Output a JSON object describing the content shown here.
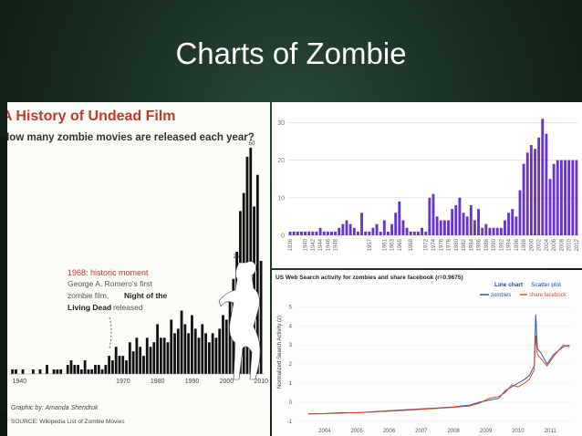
{
  "slide": {
    "title": "Charts of Zombie"
  },
  "colors": {
    "background": "#1d3528",
    "bar_purple": "#6a35c9",
    "zombies_line": "#2a56b8",
    "facebook_line": "#d6501f",
    "film_bar": "#111111"
  },
  "chart_data": [
    {
      "type": "bar",
      "title": "A History of Undead Film",
      "subtitle": "How many zombie movies are released each year?",
      "x_tick_labels": [
        "1940",
        "1970",
        "1980",
        "1990",
        "2000",
        "2010"
      ],
      "x": [
        1938,
        1939,
        1941,
        1944,
        1946,
        1948,
        1950,
        1951,
        1952,
        1954,
        1955,
        1956,
        1957,
        1958,
        1959,
        1960,
        1961,
        1962,
        1963,
        1964,
        1965,
        1966,
        1967,
        1968,
        1969,
        1970,
        1971,
        1972,
        1973,
        1974,
        1975,
        1976,
        1977,
        1978,
        1979,
        1980,
        1981,
        1982,
        1983,
        1984,
        1985,
        1986,
        1987,
        1988,
        1989,
        1990,
        1991,
        1992,
        1993,
        1994,
        1995,
        1996,
        1997,
        1998,
        1999,
        2000,
        2001,
        2002,
        2003,
        2004,
        2005,
        2006,
        2007,
        2008,
        2009,
        2010
      ],
      "values": [
        1,
        1,
        1,
        1,
        1,
        2,
        1,
        1,
        1,
        2,
        3,
        2,
        2,
        1,
        3,
        1,
        1,
        2,
        2,
        1,
        2,
        4,
        3,
        6,
        4,
        4,
        3,
        7,
        5,
        8,
        6,
        4,
        8,
        6,
        7,
        11,
        8,
        8,
        7,
        12,
        9,
        10,
        14,
        11,
        9,
        13,
        10,
        8,
        11,
        9,
        7,
        9,
        8,
        10,
        13,
        12,
        16,
        21,
        27,
        36,
        40,
        48,
        50,
        37,
        44,
        25
      ],
      "labels_on_bars": [
        "50",
        "25"
      ],
      "annotation": {
        "heading": "1968: historic moment",
        "body": [
          "George A. Romero's first",
          "zombie film,",
          "Night of the",
          "Living Dead",
          "released"
        ]
      },
      "credits": [
        "Graphic by: Amanda Shendruk",
        "SOURCE: Wikipedia List of Zombie Movies"
      ],
      "ylim": [
        0,
        52
      ]
    },
    {
      "type": "bar",
      "x": [
        "1936",
        "1940",
        "1942",
        "1944",
        "1946",
        "1948",
        "1957",
        "1961",
        "1963",
        "1965",
        "1968",
        "1972",
        "1974",
        "1976",
        "1978",
        "1980",
        "1982",
        "1984",
        "1986",
        "1988",
        "1990",
        "1992",
        "1994",
        "1996",
        "1998",
        "2000",
        "2002",
        "2004",
        "2006",
        "2008",
        "2010",
        "2012"
      ],
      "all_years": [
        1936,
        1937,
        1938,
        1939,
        1940,
        1941,
        1942,
        1943,
        1944,
        1945,
        1946,
        1947,
        1948,
        1949,
        1950,
        1951,
        1952,
        1953,
        1954,
        1955,
        1956,
        1957,
        1958,
        1959,
        1960,
        1961,
        1962,
        1963,
        1964,
        1965,
        1966,
        1967,
        1968,
        1969,
        1970,
        1971,
        1972,
        1973,
        1974,
        1975,
        1976,
        1977,
        1978,
        1979,
        1980,
        1981,
        1982,
        1983,
        1984,
        1985,
        1986,
        1987,
        1988,
        1989,
        1990,
        1991,
        1992,
        1993,
        1994,
        1995,
        1996,
        1997,
        1998,
        1999,
        2000,
        2001,
        2002,
        2003,
        2004,
        2005,
        2006,
        2007,
        2008,
        2009,
        2010,
        2011,
        2012
      ],
      "values": [
        1,
        1,
        1,
        1,
        1,
        1,
        1,
        1,
        2,
        1,
        1,
        1,
        1,
        2,
        3,
        4,
        3,
        2,
        1,
        6,
        1,
        1,
        2,
        3,
        1,
        4,
        1,
        3,
        6,
        9,
        4,
        2,
        1,
        1,
        1,
        2,
        1,
        10,
        11,
        5,
        4,
        4,
        4,
        7,
        8,
        10,
        6,
        5,
        8,
        4,
        7,
        2,
        3,
        2,
        2,
        2,
        2,
        4,
        6,
        7,
        5,
        12,
        19,
        22,
        24,
        23,
        26,
        31,
        27,
        15,
        19,
        20,
        20,
        20,
        20,
        20,
        20
      ],
      "ylim": [
        0,
        33
      ],
      "yticks": [
        0,
        10,
        20,
        30
      ]
    },
    {
      "type": "line",
      "title": "US Web Search activity for zombies and share facebook (r=0.9675)",
      "view_options": [
        "Line chart",
        "Scatter plot"
      ],
      "legend": [
        "zombies",
        "share facebook"
      ],
      "ylabel": "Normalized Search Activity (z)",
      "x_ticks": [
        "2004",
        "2005",
        "2006",
        "2007",
        "2008",
        "2009",
        "2010",
        "2011"
      ],
      "yticks": [
        -1,
        0,
        1,
        2,
        3,
        4,
        5
      ],
      "ylim": [
        -1.2,
        5.5
      ],
      "series": [
        {
          "name": "zombies",
          "x": [
            2004.0,
            2004.5,
            2005.0,
            2005.5,
            2006.0,
            2006.5,
            2007.0,
            2007.5,
            2008.0,
            2008.5,
            2009.0,
            2009.3,
            2009.6,
            2009.9,
            2010.1,
            2010.3,
            2010.5,
            2010.7,
            2010.85,
            2011.0,
            2011.05,
            2011.1,
            2011.2,
            2011.4,
            2011.6,
            2011.9,
            2012.1
          ],
          "values": [
            -0.6,
            -0.6,
            -0.55,
            -0.55,
            -0.5,
            -0.45,
            -0.4,
            -0.35,
            -0.3,
            -0.25,
            -0.15,
            0.0,
            0.1,
            0.2,
            0.6,
            0.8,
            1.0,
            1.2,
            1.4,
            1.9,
            4.6,
            2.8,
            2.6,
            2.0,
            2.5,
            2.9,
            3.0
          ]
        },
        {
          "name": "share facebook",
          "x": [
            2004.0,
            2004.5,
            2005.0,
            2005.5,
            2006.0,
            2006.5,
            2007.0,
            2007.5,
            2008.0,
            2008.5,
            2009.0,
            2009.3,
            2009.6,
            2009.9,
            2010.1,
            2010.3,
            2010.5,
            2010.7,
            2010.85,
            2011.0,
            2011.05,
            2011.1,
            2011.2,
            2011.4,
            2011.6,
            2011.9,
            2012.1
          ],
          "values": [
            -0.62,
            -0.6,
            -0.58,
            -0.55,
            -0.52,
            -0.47,
            -0.43,
            -0.37,
            -0.33,
            -0.27,
            -0.2,
            -0.05,
            0.2,
            0.3,
            0.5,
            0.9,
            0.8,
            1.0,
            1.2,
            1.7,
            3.5,
            2.5,
            2.3,
            1.9,
            2.4,
            3.0,
            2.9
          ]
        }
      ]
    }
  ]
}
